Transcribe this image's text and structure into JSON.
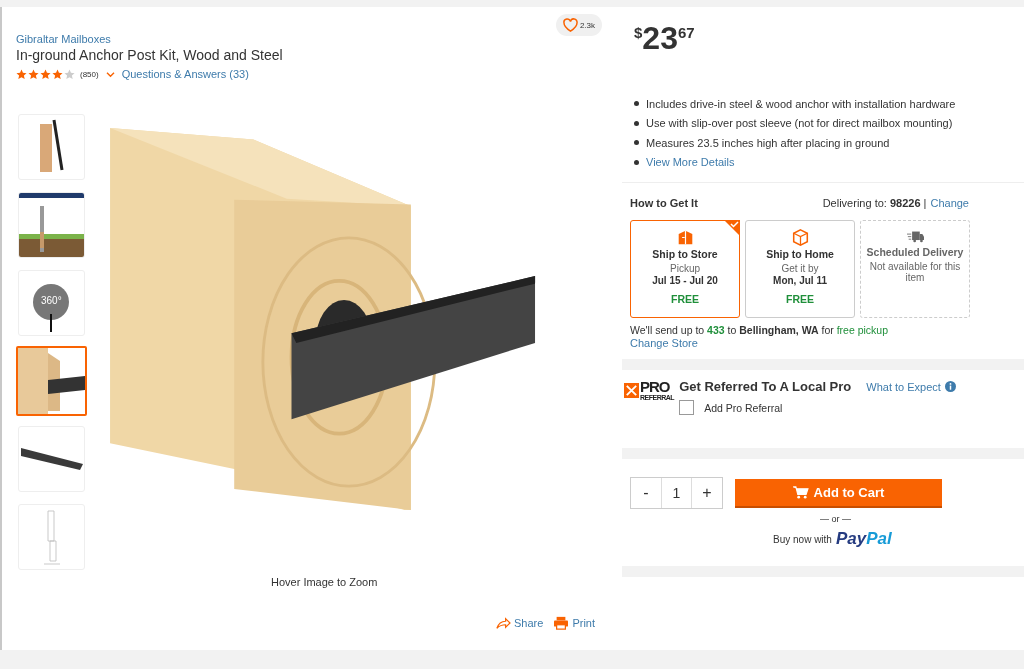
{
  "product": {
    "brand": "Gibraltar Mailboxes",
    "title": "In-ground Anchor Post Kit, Wood and Steel",
    "stars": 4,
    "review_count": "(850)",
    "qa_link": "Questions & Answers (33)",
    "favorites": "2.3k"
  },
  "gallery": {
    "thumbnails": [
      {
        "kind": "post",
        "selected": false
      },
      {
        "kind": "diagram",
        "selected": false
      },
      {
        "kind": "spin",
        "label": "360°",
        "selected": false
      },
      {
        "kind": "block",
        "selected": true
      },
      {
        "kind": "bar",
        "selected": false
      },
      {
        "kind": "drawing",
        "selected": false
      }
    ],
    "hint": "Hover Image to Zoom",
    "share": "Share",
    "print": "Print"
  },
  "price": {
    "currency": "$",
    "dollars": "23",
    "cents": "67"
  },
  "highlights": [
    {
      "text": "Includes drive-in steel & wood anchor with installation hardware",
      "kind": "feature"
    },
    {
      "text": "Use with slip-over post sleeve (not for direct mailbox mounting)",
      "kind": "feature"
    },
    {
      "text": "Measures 23.5 inches high after placing in ground",
      "kind": "feature"
    },
    {
      "text": "View More Details",
      "kind": "link"
    }
  ],
  "fulfillment": {
    "heading": "How to Get It",
    "delivering": "Delivering to: **98226** |",
    "change": "Change",
    "options": [
      {
        "kind": "store",
        "title": "Ship to Store",
        "line_1": "Pickup",
        "line_2": "Jul 15 - Jul 20",
        "cost": "FREE",
        "selected": true,
        "disabled": false
      },
      {
        "kind": "home",
        "title": "Ship to Home",
        "line_1": "Get it by",
        "line_2": "Mon, Jul 11",
        "cost": "FREE",
        "selected": false,
        "disabled": false
      },
      {
        "kind": "truck",
        "title": "Scheduled Delivery",
        "line_1": "Not available for this item",
        "selected": false,
        "disabled": true
      }
    ],
    "note": [
      {
        "text": "We'll send up to ",
        "kind": "plain"
      },
      {
        "text": "433",
        "kind": "count"
      },
      {
        "text": " to ",
        "kind": "plain"
      },
      {
        "text": "Bellingham, WA",
        "kind": "place"
      },
      {
        "text": " for ",
        "kind": "plain"
      },
      {
        "text": "free pickup",
        "kind": "offer"
      }
    ],
    "change_store": "Change Store"
  },
  "pro_referral": {
    "logo_top": "PRO",
    "logo_bottom": "REFERRAL",
    "heading": "Get Referred To A Local Pro",
    "link": "What to Expect",
    "checkbox": {
      "label": "Add Pro Referral",
      "checked": false
    }
  },
  "cart": {
    "minus": "-",
    "quantity": "1",
    "plus": "+",
    "button": "Add to Cart",
    "or": "— or —",
    "buy_now": "Buy now with",
    "paypal_1": "Pay",
    "paypal_2": "Pal"
  }
}
